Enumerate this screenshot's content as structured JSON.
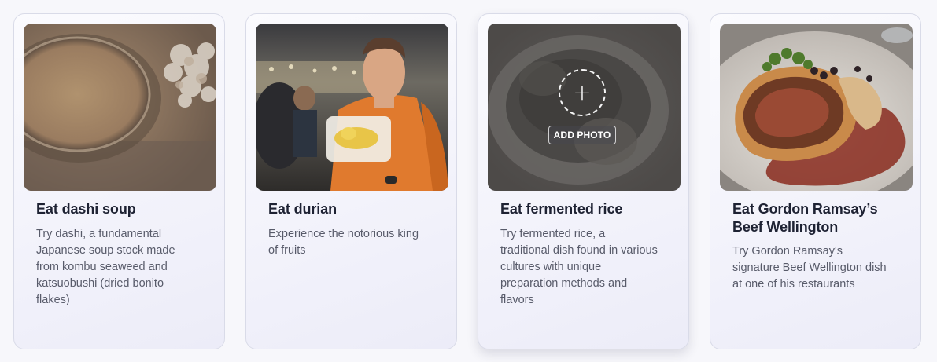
{
  "cards": [
    {
      "title": "Eat dashi soup",
      "description": "Try dashi, a fundamental Japanese soup stock made from kombu seaweed and katsuobushi (dried bonito flakes)",
      "has_photo": true
    },
    {
      "title": "Eat durian",
      "description": "Experience the notorious king of fruits",
      "has_photo": true
    },
    {
      "title": "Eat fermented rice",
      "description": "Try fermented rice, a traditional dish found in various cultures with unique preparation methods and flavors",
      "has_photo": false,
      "add_photo_label": "ADD PHOTO",
      "add_icon": "+"
    },
    {
      "title": "Eat Gordon Ramsay’s Beef Wellington",
      "description": "Try Gordon Ramsay's signature Beef Wellington dish at one of his restaurants",
      "has_photo": true
    }
  ],
  "colors": {
    "page_background": "#f7f7fb",
    "card_border": "#d9dbe8",
    "title_text": "#1e2233",
    "description_text": "#585b6a"
  }
}
